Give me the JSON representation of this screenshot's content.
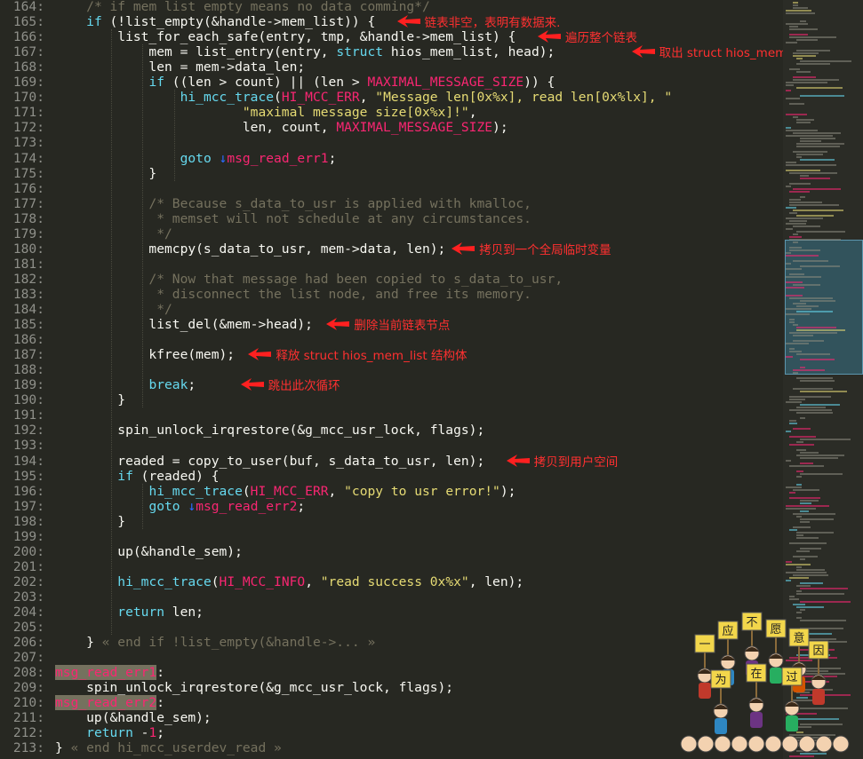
{
  "editor": {
    "theme_colors": {
      "background": "#272822",
      "keyword": "#66d9ef",
      "string": "#e6db74",
      "macro": "#f92672",
      "comment": "#75715e",
      "annotation": "#ff3030",
      "jump_arrow": "#2b6cff"
    },
    "line_numbers": [
      "164:",
      "165:",
      "166:",
      "167:",
      "168:",
      "169:",
      "170:",
      "171:",
      "172:",
      "173:",
      "174:",
      "175:",
      "176:",
      "177:",
      "178:",
      "179:",
      "180:",
      "181:",
      "182:",
      "183:",
      "184:",
      "185:",
      "186:",
      "187:",
      "188:",
      "189:",
      "190:",
      "191:",
      "192:",
      "193:",
      "194:",
      "195:",
      "196:",
      "197:",
      "198:",
      "199:",
      "200:",
      "201:",
      "202:",
      "203:",
      "204:",
      "205:",
      "206:",
      "207:",
      "208:",
      "209:",
      "210:",
      "211:",
      "212:",
      "213:"
    ],
    "lines": [
      [
        {
          "t": "    "
        },
        {
          "c": "com",
          "t": "/* if mem list empty means no data comming*/"
        }
      ],
      [
        {
          "t": "    "
        },
        {
          "c": "kw",
          "t": "if"
        },
        {
          "t": " (!list_empty(&handle->mem_list)) {"
        }
      ],
      [
        {
          "t": "        list_for_each_safe(entry, tmp, &handle->mem_list) {"
        }
      ],
      [
        {
          "t": "            mem = list_entry(entry, "
        },
        {
          "c": "kw",
          "t": "struct"
        },
        {
          "t": " hios_mem_list, head);"
        }
      ],
      [
        {
          "t": "            len = mem->data_len;"
        }
      ],
      [
        {
          "t": "            "
        },
        {
          "c": "kw",
          "t": "if"
        },
        {
          "t": " ((len > count) || (len > "
        },
        {
          "c": "mac",
          "t": "MAXIMAL_MESSAGE_SIZE"
        },
        {
          "t": ")) {"
        }
      ],
      [
        {
          "t": "                "
        },
        {
          "c": "kw",
          "t": "hi_mcc_trace"
        },
        {
          "t": "("
        },
        {
          "c": "mac",
          "t": "HI_MCC_ERR"
        },
        {
          "t": ", "
        },
        {
          "c": "str",
          "t": "\"Message len[0x%x], read len[0x%lx], \""
        }
      ],
      [
        {
          "t": "                        "
        },
        {
          "c": "str",
          "t": "\"maximal message size[0x%x]!\""
        },
        {
          "t": ","
        }
      ],
      [
        {
          "t": "                        len, count, "
        },
        {
          "c": "mac",
          "t": "MAXIMAL_MESSAGE_SIZE"
        },
        {
          "t": ");"
        }
      ],
      [
        {
          "t": ""
        }
      ],
      [
        {
          "t": "                "
        },
        {
          "c": "kw",
          "t": "goto"
        },
        {
          "t": " "
        },
        {
          "c": "arrow",
          "t": "↓"
        },
        {
          "c": "mac",
          "t": "msg_read_err1"
        },
        {
          "t": ";"
        }
      ],
      [
        {
          "t": "            }"
        }
      ],
      [
        {
          "t": ""
        }
      ],
      [
        {
          "t": "            "
        },
        {
          "c": "com",
          "t": "/* Because s_data_to_usr is applied with kmalloc,"
        }
      ],
      [
        {
          "t": "             "
        },
        {
          "c": "com",
          "t": "* memset will not schedule at any circumstances."
        }
      ],
      [
        {
          "t": "             "
        },
        {
          "c": "com",
          "t": "*/"
        }
      ],
      [
        {
          "t": "            memcpy(s_data_to_usr, mem->data, len);"
        }
      ],
      [
        {
          "t": ""
        }
      ],
      [
        {
          "t": "            "
        },
        {
          "c": "com",
          "t": "/* Now that message had been copied to s_data_to_usr,"
        }
      ],
      [
        {
          "t": "             "
        },
        {
          "c": "com",
          "t": "* disconnect the list node, and free its memory."
        }
      ],
      [
        {
          "t": "             "
        },
        {
          "c": "com",
          "t": "*/"
        }
      ],
      [
        {
          "t": "            list_del(&mem->head);"
        }
      ],
      [
        {
          "t": ""
        }
      ],
      [
        {
          "t": "            kfree(mem);"
        }
      ],
      [
        {
          "t": ""
        }
      ],
      [
        {
          "t": "            "
        },
        {
          "c": "kw",
          "t": "break"
        },
        {
          "t": ";"
        }
      ],
      [
        {
          "t": "        }"
        }
      ],
      [
        {
          "t": ""
        }
      ],
      [
        {
          "t": "        spin_unlock_irqrestore(&g_mcc_usr_lock, flags);"
        }
      ],
      [
        {
          "t": ""
        }
      ],
      [
        {
          "t": "        readed = copy_to_user(buf, s_data_to_usr, len);"
        }
      ],
      [
        {
          "t": "        "
        },
        {
          "c": "kw",
          "t": "if"
        },
        {
          "t": " (readed) {"
        }
      ],
      [
        {
          "t": "            "
        },
        {
          "c": "kw",
          "t": "hi_mcc_trace"
        },
        {
          "t": "("
        },
        {
          "c": "mac",
          "t": "HI_MCC_ERR"
        },
        {
          "t": ", "
        },
        {
          "c": "str",
          "t": "\"copy to usr error!\""
        },
        {
          "t": ");"
        }
      ],
      [
        {
          "t": "            "
        },
        {
          "c": "kw",
          "t": "goto"
        },
        {
          "t": " "
        },
        {
          "c": "arrow",
          "t": "↓"
        },
        {
          "c": "mac",
          "t": "msg_read_err2"
        },
        {
          "t": ";"
        }
      ],
      [
        {
          "t": "        }"
        }
      ],
      [
        {
          "t": ""
        }
      ],
      [
        {
          "t": "        up(&handle_sem);"
        }
      ],
      [
        {
          "t": ""
        }
      ],
      [
        {
          "t": "        "
        },
        {
          "c": "kw",
          "t": "hi_mcc_trace"
        },
        {
          "t": "("
        },
        {
          "c": "mac",
          "t": "HI_MCC_INFO"
        },
        {
          "t": ", "
        },
        {
          "c": "str",
          "t": "\"read success 0x%x\""
        },
        {
          "t": ", len);"
        }
      ],
      [
        {
          "t": ""
        }
      ],
      [
        {
          "t": "        "
        },
        {
          "c": "kw",
          "t": "return"
        },
        {
          "t": " len;"
        }
      ],
      [
        {
          "t": ""
        }
      ],
      [
        {
          "t": "    } "
        },
        {
          "c": "fold",
          "t": "« end if !list_empty(&handle->... »"
        }
      ],
      [
        {
          "t": ""
        }
      ],
      [
        {
          "c": "lbl",
          "t": "msg_read_err1"
        },
        {
          "t": ":"
        }
      ],
      [
        {
          "t": "    spin_unlock_irqrestore(&g_mcc_usr_lock, flags);"
        }
      ],
      [
        {
          "c": "lbl",
          "t": "msg_read_err2"
        },
        {
          "t": ":"
        }
      ],
      [
        {
          "t": "    up(&handle_sem);"
        }
      ],
      [
        {
          "t": "    "
        },
        {
          "c": "kw",
          "t": "return"
        },
        {
          "t": " -"
        },
        {
          "c": "mac",
          "t": "1"
        },
        {
          "t": ";"
        }
      ],
      [
        {
          "t": "} "
        },
        {
          "c": "fold",
          "t": "« end hi_mcc_userdev_read »"
        }
      ]
    ]
  },
  "annotations": [
    {
      "line": 1,
      "text": "链表非空，表明有数据来."
    },
    {
      "line": 2,
      "text": "遍历整个链表"
    },
    {
      "line": 3,
      "text": "取出 struct hios_mem_list 结构体"
    },
    {
      "line": 16,
      "text": "拷贝到一个全局临时变量"
    },
    {
      "line": 21,
      "text": "删除当前链表节点"
    },
    {
      "line": 23,
      "text": "释放 struct hios_mem_list 结构体"
    },
    {
      "line": 25,
      "text": "跳出此次循环"
    },
    {
      "line": 30,
      "text": "拷贝到用户空间"
    }
  ],
  "sticker": {
    "signs": [
      "一",
      "应",
      "不",
      "愿",
      "意",
      "因",
      "为",
      "在",
      "过"
    ]
  }
}
